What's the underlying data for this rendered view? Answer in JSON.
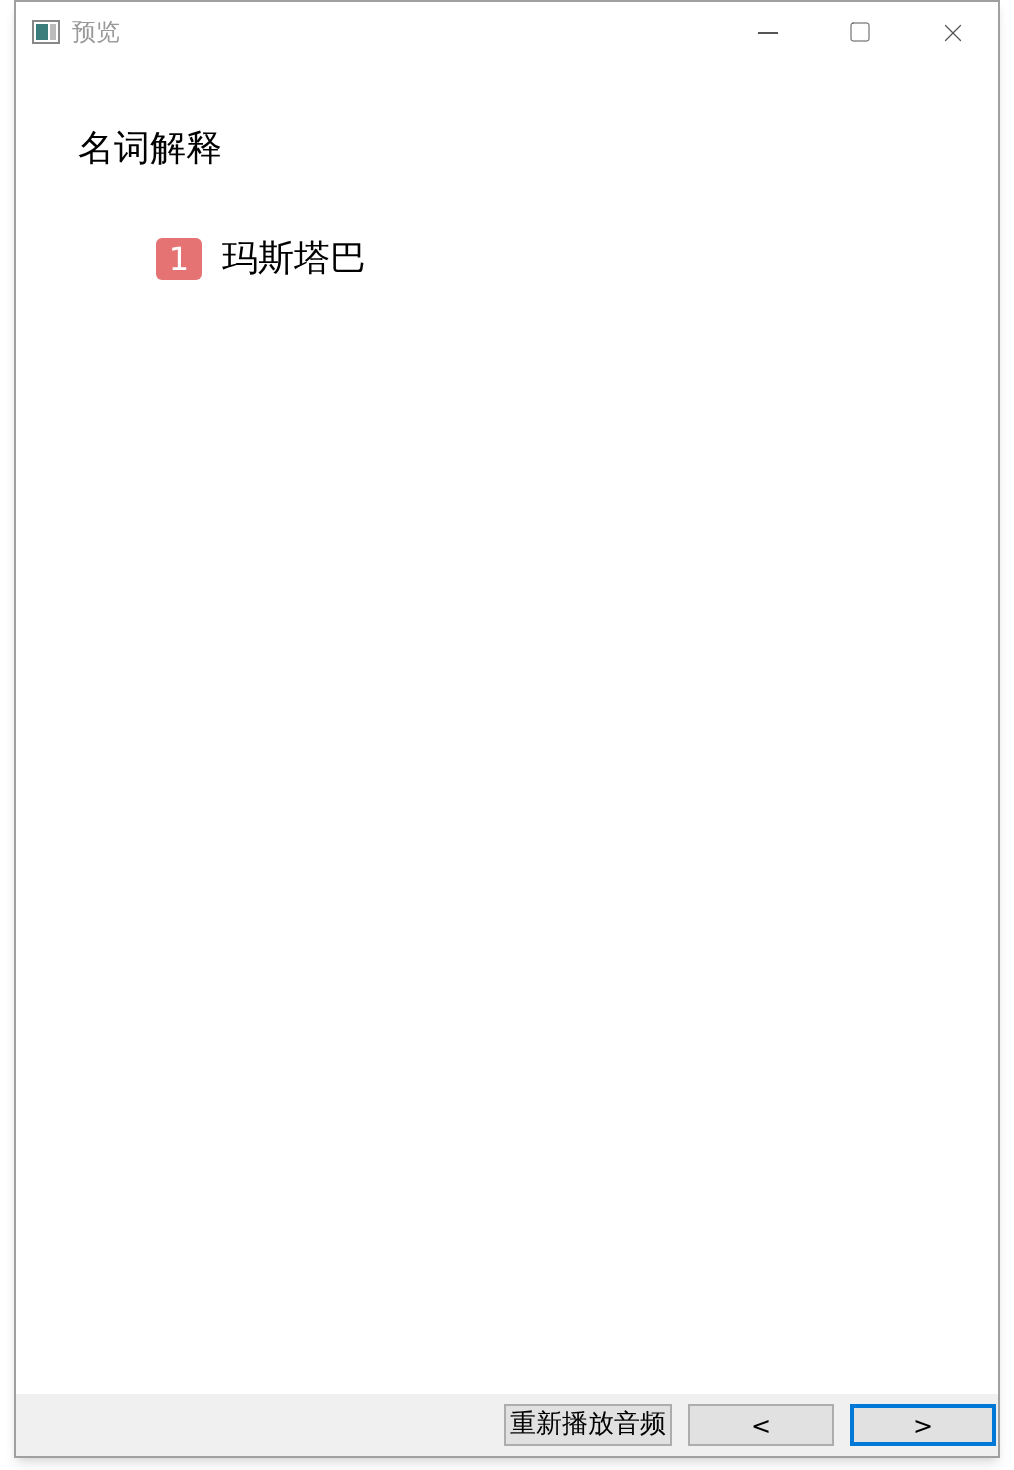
{
  "window": {
    "title": "预览"
  },
  "content": {
    "heading": "名词解释",
    "items": [
      {
        "number": "1",
        "text": "玛斯塔巴"
      }
    ]
  },
  "footer": {
    "buttons": [
      {
        "label": "重新播放音频",
        "focused": false,
        "kind": "text"
      },
      {
        "label": "<",
        "focused": false,
        "kind": "nav"
      },
      {
        "label": ">",
        "focused": true,
        "kind": "nav"
      }
    ]
  }
}
